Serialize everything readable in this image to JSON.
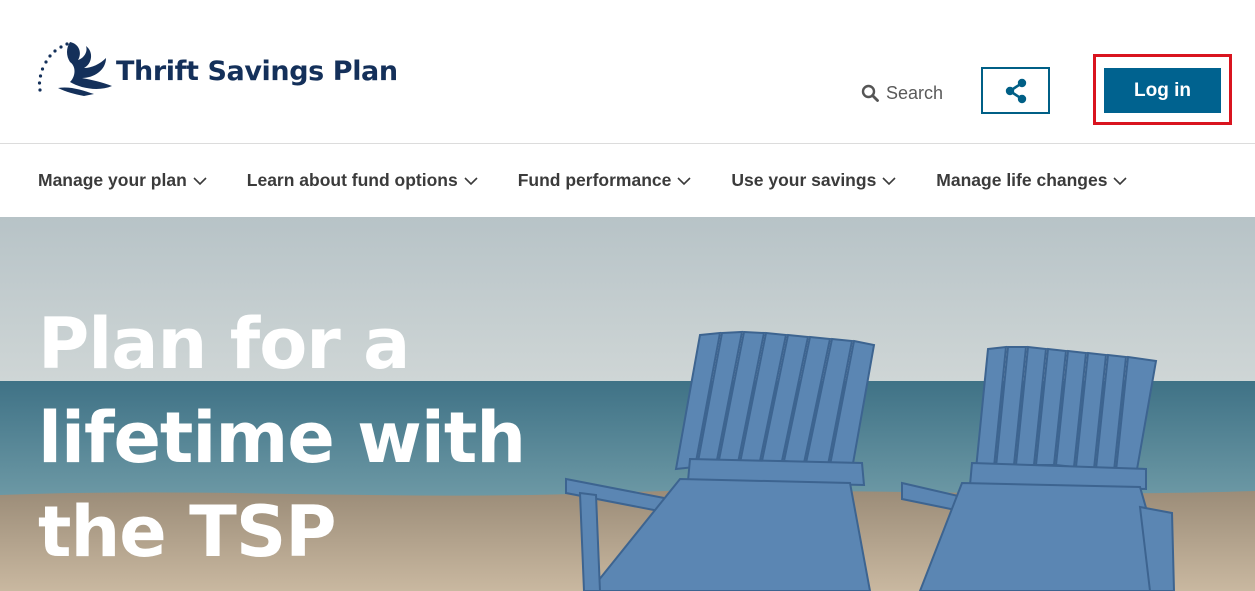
{
  "header": {
    "logo_text": "Thrift Savings Plan",
    "search_label": "Search",
    "share_icon": "share-icon",
    "login_label": "Log in"
  },
  "nav": {
    "items": [
      {
        "label": "Manage your plan"
      },
      {
        "label": "Learn about fund options"
      },
      {
        "label": "Fund performance"
      },
      {
        "label": "Use your savings"
      },
      {
        "label": "Manage life changes"
      }
    ]
  },
  "hero": {
    "title_line1": "Plan for a",
    "title_line2": "lifetime with",
    "title_line3": "the TSP"
  },
  "colors": {
    "brand_navy": "#14305a",
    "accent_blue": "#00628f",
    "highlight_red": "#d9141f"
  }
}
